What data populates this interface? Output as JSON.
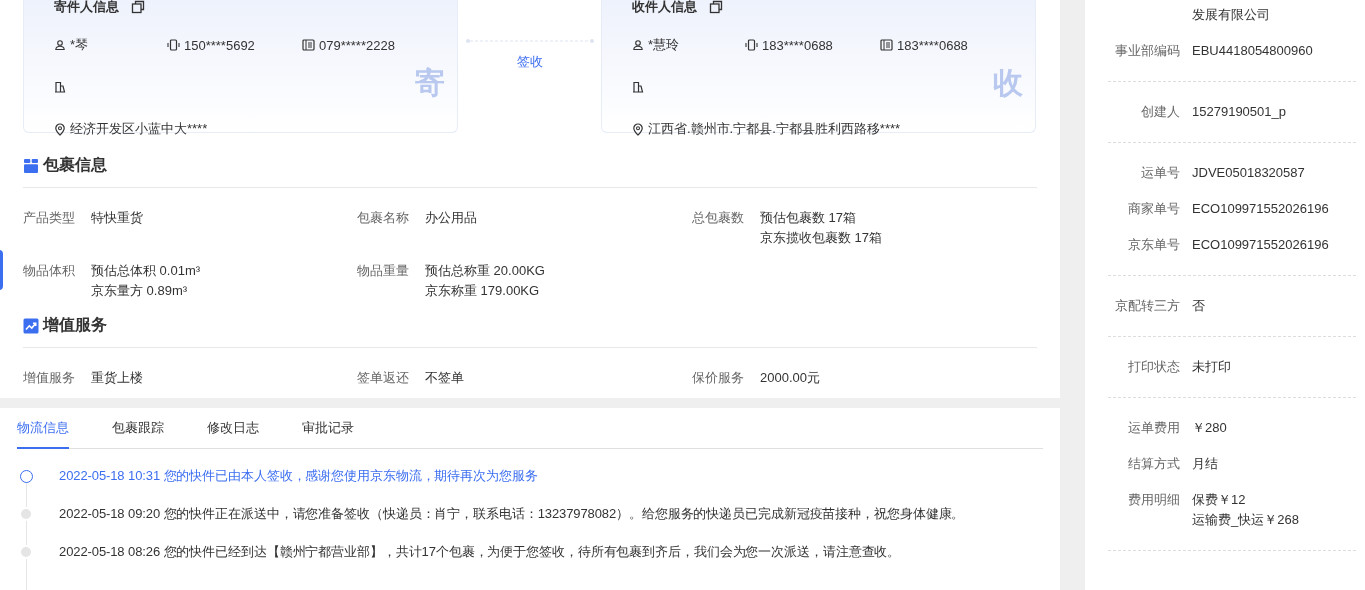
{
  "cards": [
    {
      "title": "寄件人信息",
      "name": "*琴",
      "mobile": "150****5692",
      "phone": "079*****2228",
      "address": "经济开发区小蓝中大****",
      "stamp": "寄"
    },
    {
      "title": "收件人信息",
      "name": "*慧玲",
      "mobile": "183****0688",
      "phone": "183****0688",
      "address": "江西省.赣州市.宁都县.宁都县胜利西路移****",
      "stamp": "收"
    }
  ],
  "status_link": "签收",
  "sections": [
    {
      "kind": "package",
      "title": "包裹信息",
      "fields": [
        {
          "label": "产品类型",
          "values": [
            "特快重货"
          ]
        },
        {
          "label": "包裹名称",
          "values": [
            "办公用品"
          ]
        },
        {
          "label": "总包裹数",
          "values": [
            "预估包裹数 17箱",
            "京东揽收包裹数 17箱"
          ]
        },
        {
          "label": "物品体积",
          "values": [
            "预估总体积 0.01m³",
            "京东量方 0.89m³"
          ]
        },
        {
          "label": "物品重量",
          "values": [
            "预估总称重 20.00KG",
            "京东称重 179.00KG"
          ]
        }
      ]
    },
    {
      "kind": "trend",
      "title": "增值服务",
      "fields": [
        {
          "label": "增值服务",
          "values": [
            "重货上楼"
          ]
        },
        {
          "label": "签单返还",
          "values": [
            "不签单"
          ]
        },
        {
          "label": "保价服务",
          "values": [
            "2000.00元"
          ]
        }
      ]
    }
  ],
  "tabs": [
    {
      "label": "物流信息",
      "selected": true
    },
    {
      "label": "包裹跟踪",
      "selected": false
    },
    {
      "label": "修改日志",
      "selected": false
    },
    {
      "label": "审批记录",
      "selected": false
    }
  ],
  "timeline": [
    {
      "text": "2022-05-18 10:31 您的快件已由本人签收，感谢您使用京东物流，期待再次为您服务",
      "active": true
    },
    {
      "text": "2022-05-18 09:20 您的快件正在派送中，请您准备签收（快递员：肖宁，联系电话：13237978082）。给您服务的快递员已完成新冠疫苗接种，祝您身体健康。",
      "active": false
    },
    {
      "text": "2022-05-18 08:26 您的快件已经到达【赣州宁都营业部】，共计17个包裹，为便于您签收，待所有包裹到齐后，我们会为您一次派送，请注意查收。",
      "active": false
    }
  ],
  "side_panel": [
    {
      "items": [
        {
          "values": [
            "发展有限公司"
          ]
        },
        {
          "label": "事业部编码",
          "values": [
            "EBU4418054800960"
          ]
        }
      ]
    },
    {
      "items": [
        {
          "label": "创建人",
          "values": [
            "15279190501_p"
          ]
        }
      ]
    },
    {
      "items": [
        {
          "label": "运单号",
          "values": [
            "JDVE05018320587"
          ]
        },
        {
          "label": "商家单号",
          "values": [
            "ECO109971552026196"
          ]
        },
        {
          "label": "京东单号",
          "values": [
            "ECO109971552026196"
          ]
        }
      ]
    },
    {
      "items": [
        {
          "label": "京配转三方",
          "values": [
            "否"
          ]
        }
      ]
    },
    {
      "items": [
        {
          "label": "打印状态",
          "values": [
            "未打印"
          ]
        }
      ]
    },
    {
      "items": [
        {
          "label": "运单费用",
          "values": [
            "￥280"
          ]
        },
        {
          "label": "结算方式",
          "values": [
            "月结"
          ]
        },
        {
          "label": "费用明细",
          "values": [
            "保费￥12",
            "运输费_快运￥268"
          ]
        }
      ]
    }
  ]
}
